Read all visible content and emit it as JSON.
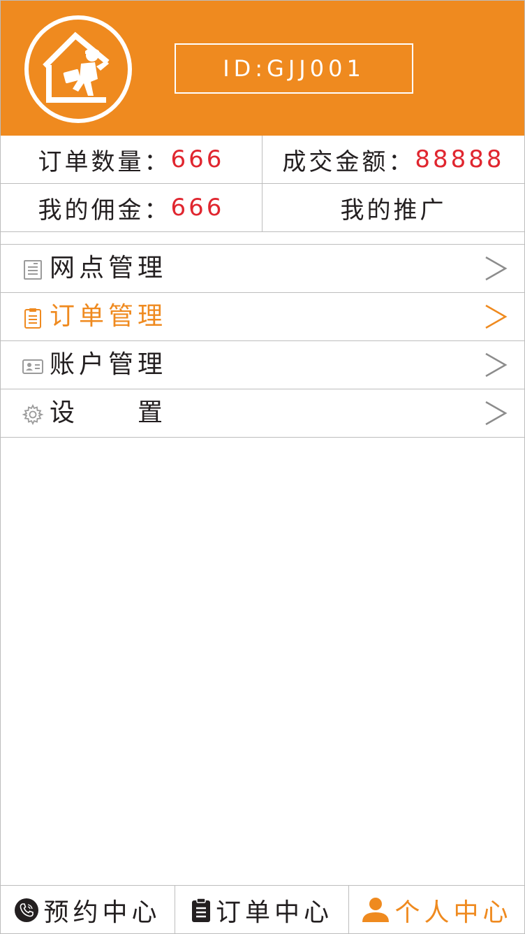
{
  "header": {
    "user_id": "ID:GJJ001",
    "logo_icon": "house-repairman-logo",
    "brand_color": "#ef8a1f"
  },
  "stats": {
    "order_count": {
      "label": "订单数量：",
      "value": "666"
    },
    "deal_amount": {
      "label": "成交金额：",
      "value": "88888"
    },
    "commission": {
      "label": "我的佣金：",
      "value": "666"
    },
    "promotion": {
      "label": "我的推广"
    },
    "value_color": "#e0262f"
  },
  "menu": {
    "items": [
      {
        "label": "网点管理",
        "icon": "document-list-icon",
        "active": false
      },
      {
        "label": "订单管理",
        "icon": "clipboard-icon",
        "active": true
      },
      {
        "label": "账户管理",
        "icon": "id-card-icon",
        "active": false
      },
      {
        "label": "设　　置",
        "icon": "gear-icon",
        "active": false
      }
    ],
    "chevron": ">"
  },
  "tabbar": {
    "tabs": [
      {
        "label": "预约中心",
        "icon": "phone-icon",
        "active": false
      },
      {
        "label": "订单中心",
        "icon": "clipboard-icon",
        "active": false
      },
      {
        "label": "个人中心",
        "icon": "user-icon",
        "active": true
      }
    ]
  }
}
